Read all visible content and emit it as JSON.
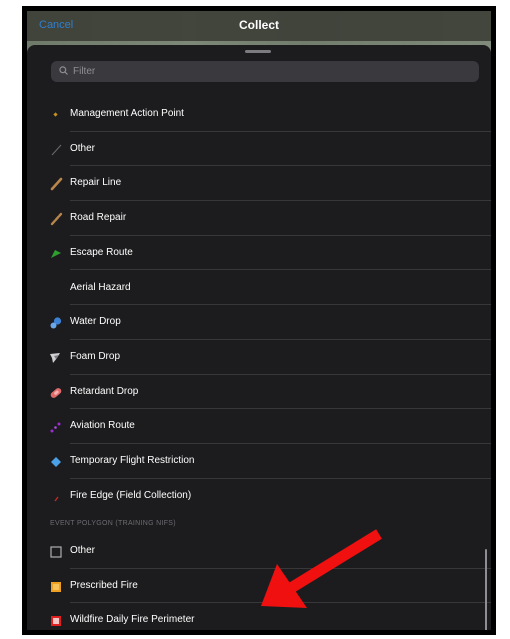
{
  "header": {
    "cancel_label": "Cancel",
    "title": "Collect"
  },
  "filter": {
    "placeholder": "Filter"
  },
  "section_header": "EVENT POLYGON (TRAINING NIFS)",
  "items": [
    {
      "label": "Management Action Point",
      "icon": "diamond-icon",
      "color": "#c8901e"
    },
    {
      "label": "Other",
      "icon": "line-icon",
      "color": "#6b6b6e"
    },
    {
      "label": "Repair Line",
      "icon": "line-icon",
      "color": "#b8864a"
    },
    {
      "label": "Road Repair",
      "icon": "line-icon",
      "color": "#b8864a"
    },
    {
      "label": "Escape Route",
      "icon": "arrow-icon",
      "color": "#2e9e31"
    },
    {
      "label": "Aerial Hazard",
      "icon": "",
      "color": ""
    },
    {
      "label": "Water Drop",
      "icon": "drops-icon",
      "color": "#3d82d6"
    },
    {
      "label": "Foam Drop",
      "icon": "drops-icon",
      "color": "#d0d0d4"
    },
    {
      "label": "Retardant Drop",
      "icon": "drops-icon",
      "color": "#e06a6a"
    },
    {
      "label": "Aviation Route",
      "icon": "dotted-line-icon",
      "color": "#9a2bd6"
    },
    {
      "label": "Temporary Flight Restriction",
      "icon": "diamond-icon",
      "color": "#4aa1e8"
    },
    {
      "label": "Fire Edge (Field Collection)",
      "icon": "line-icon",
      "color": "#c02a2a"
    },
    {
      "label": "Other",
      "icon": "square-outline-icon",
      "color": "#b0b0b4"
    },
    {
      "label": "Prescribed Fire",
      "icon": "square-icon",
      "color": "#f0a020"
    },
    {
      "label": "Wildfire Daily Fire Perimeter",
      "icon": "square-icon",
      "color": "#e02020"
    }
  ],
  "colors": {
    "background": "#1c1c1e",
    "accent": "#2f7fd0",
    "annotation_arrow": "#f01010"
  }
}
